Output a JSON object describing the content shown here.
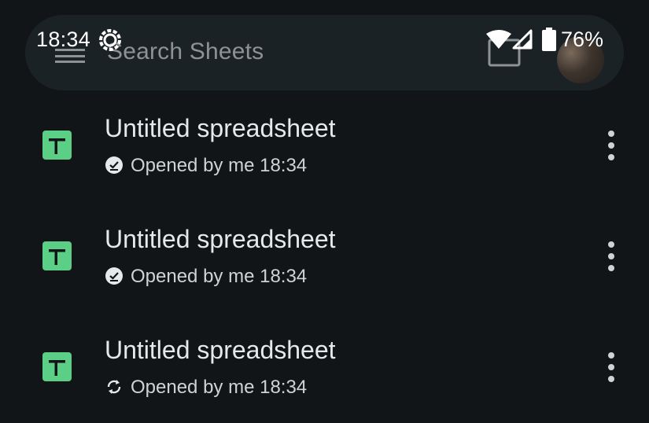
{
  "status_bar": {
    "time": "18:34",
    "battery": "76%"
  },
  "search": {
    "placeholder": "Search Sheets"
  },
  "files": [
    {
      "title": "Untitled spreadsheet",
      "subtitle": "Opened by me 18:34",
      "status_icon": "offline-done-icon"
    },
    {
      "title": "Untitled spreadsheet",
      "subtitle": "Opened by me 18:34",
      "status_icon": "offline-done-icon"
    },
    {
      "title": "Untitled spreadsheet",
      "subtitle": "Opened by me 18:34",
      "status_icon": "sync-icon"
    }
  ],
  "colors": {
    "background": "#121517",
    "search_bar": "#1b2226",
    "sheets_green": "#5bcf86",
    "text_primary": "#e6e8ea",
    "text_secondary": "#cfd3d6",
    "placeholder": "#8c9296"
  }
}
